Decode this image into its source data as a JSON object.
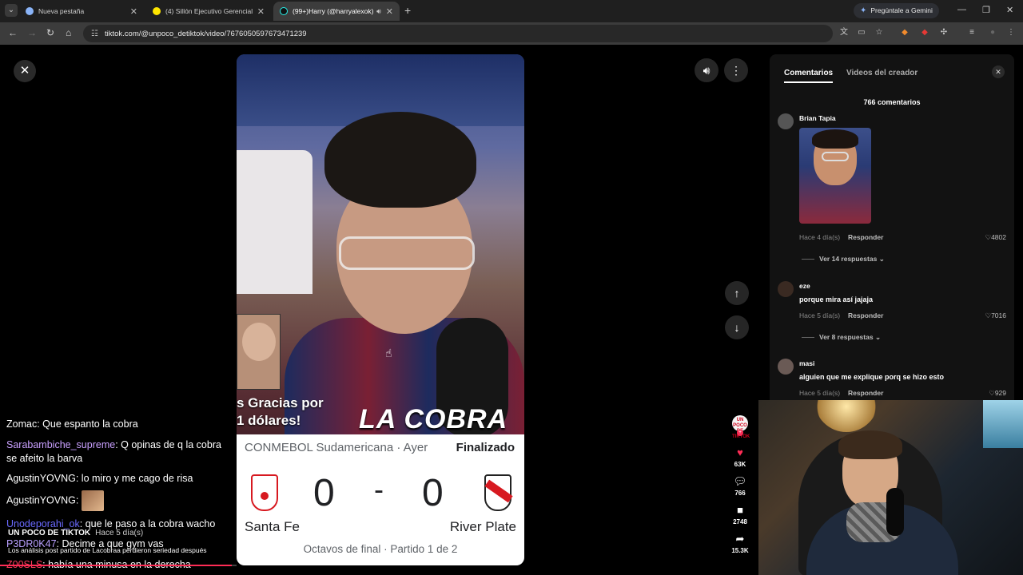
{
  "browser": {
    "tabs": [
      {
        "title": "Nueva pestaña",
        "close": "✕"
      },
      {
        "title": "(4) Sillón Ejecutivo Gerencial Re",
        "close": "✕"
      },
      {
        "title": "(99+)Harry (@harryalexok)",
        "close": "✕"
      }
    ],
    "new_tab": "+",
    "gemini_label": "Pregúntale a Gemini",
    "url": "tiktok.com/@unpoco_detiktok/video/7676050597673471239"
  },
  "video": {
    "overlay_gracias_line1": "s Gracias por",
    "overlay_gracias_line2": "1 dólares!",
    "overlay_logo": "LA COBRA",
    "scorecard": {
      "competition": "CONMEBOL Sudamericana · Ayer",
      "status": "Finalizado",
      "home_team": "Santa Fe",
      "away_team": "River Plate",
      "home_score": "0",
      "away_score": "0",
      "separator": "-",
      "round": "Octavos de final · Partido 1 de 2"
    }
  },
  "actions": {
    "creator_avatar_text": "UN POCO DE TIKTOK",
    "likes": "63K",
    "comments": "766",
    "saves": "2748",
    "shares": "15.3K"
  },
  "comments_panel": {
    "tab_comments": "Comentarios",
    "tab_creator": "Videos del creador",
    "count": "766 comentarios",
    "reply_label": "Responder",
    "items": [
      {
        "user": "Brian Tapia",
        "text": "",
        "time": "Hace 4 día(s)",
        "likes": "4802",
        "more": "Ver 14 respuestas"
      },
      {
        "user": "eze",
        "text": "porque mira así jajaja",
        "time": "Hace 5 día(s)",
        "likes": "7016",
        "more": "Ver 8 respuestas"
      },
      {
        "user": "masi",
        "text": "alguien que me explique porq se hizo esto",
        "time": "Hace 5 día(s)",
        "likes": "929",
        "more": ""
      }
    ]
  },
  "stream_chat": {
    "messages": [
      {
        "user": "Zomac",
        "color": "#ffffff",
        "text": "Que espanto la cobra"
      },
      {
        "user": "Sarabambiche_supreme",
        "color": "#c9a0ff",
        "text": "Q opinas de q la cobra"
      },
      {
        "user": "",
        "color": "#ffffff",
        "text": "se afeito la barva"
      },
      {
        "user": "AgustinYOVNG",
        "color": "#ffffff",
        "text": "lo miro y me cago de risa"
      },
      {
        "user": "AgustinYOVNG",
        "color": "#ffffff",
        "text": ""
      },
      {
        "user": "Unodeporahi_ok",
        "color": "#6a6aff",
        "text": "que le paso a la cobra wacho"
      },
      {
        "user": "P3DR0K47",
        "color": "#b9a0ff",
        "text": "Decime a que gym vas"
      },
      {
        "user": "Z00SLS",
        "color": "#ff3b5c",
        "text": "había una minusa en la derecha"
      }
    ],
    "caption_user": "UN POCO DE TIKTOK",
    "caption_time": "Hace 5 día(s)",
    "caption_text": "Los análisis post partido de Lacobraa perdieron seriedad después",
    "progress": 0.98
  }
}
